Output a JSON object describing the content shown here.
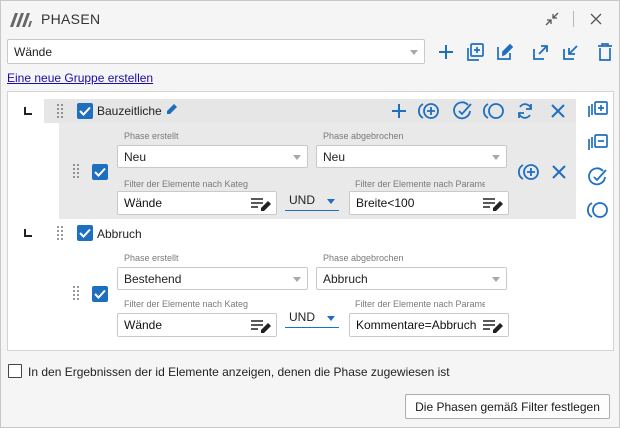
{
  "window": {
    "title": "PHASEN"
  },
  "colors": {
    "accent": "#1f6fc0",
    "group_bg": "#e6e6e6",
    "body_bg": "#f5f5f5"
  },
  "toolbar": {
    "selected_category": "Wände",
    "icons": [
      "add-icon",
      "add-copy-icon",
      "edit-icon",
      "export-icon",
      "import-icon",
      "delete-icon"
    ]
  },
  "create_group_link": "Eine neue Gruppe erstellen",
  "groups": [
    {
      "name": "Bauzeitliche",
      "checked": true,
      "rule": {
        "checked": true,
        "phase_created_label": "Phase erstellt",
        "phase_created": "Neu",
        "phase_demolished_label": "Phase abgebrochen",
        "phase_demolished": "Neu",
        "category_filter_label": "Filter der Elemente nach Katego",
        "category_filter": "Wände",
        "operator": "UND",
        "param_filter_label": "Filter der Elemente nach Parame",
        "param_filter": "Breite<100"
      }
    },
    {
      "name": "Abbruch",
      "checked": true,
      "rule": {
        "checked": true,
        "phase_created_label": "Phase erstellt",
        "phase_created": "Bestehend",
        "phase_demolished_label": "Phase abgebrochen",
        "phase_demolished": "Abbruch",
        "category_filter_label": "Filter der Elemente nach Katego",
        "category_filter": "Wände",
        "operator": "UND",
        "param_filter_label": "Filter der Elemente nach Parame",
        "param_filter": "Kommentare=Abbruch"
      }
    }
  ],
  "show_ids_checkbox": {
    "checked": false,
    "label": "In den Ergebnissen der id Elemente anzeigen, denen die Phase zugewiesen ist"
  },
  "apply_button": "Die Phasen gemäß Filter festlegen"
}
